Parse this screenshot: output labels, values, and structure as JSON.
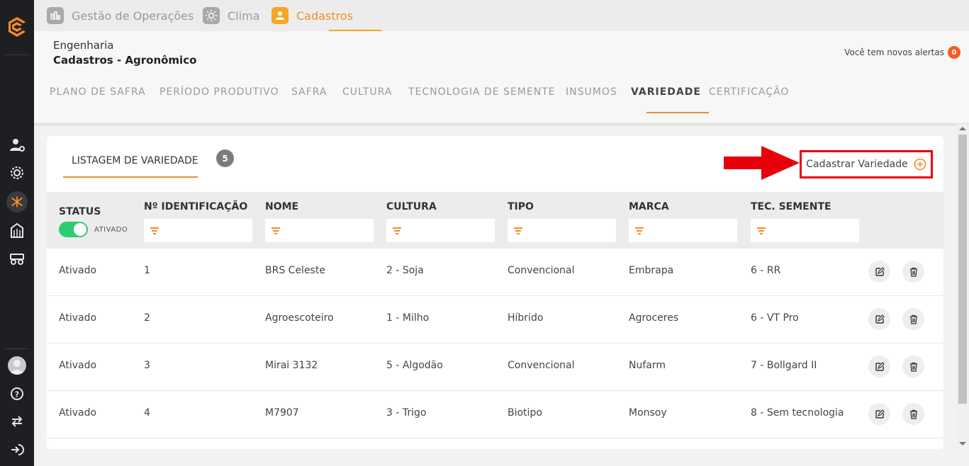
{
  "topnav": {
    "items": [
      {
        "label": "Gestão de Operações",
        "icon": "operations-icon",
        "active": false
      },
      {
        "label": "Clima",
        "icon": "sun-icon",
        "active": false
      },
      {
        "label": "Cadastros",
        "icon": "user-icon",
        "active": true
      }
    ]
  },
  "header": {
    "subtitle": "Engenharia",
    "title": "Cadastros - Agronômico",
    "alerts_label": "Você tem novos alertas",
    "alerts_count": "0"
  },
  "subtabs": [
    "PLANO DE SAFRA",
    "PERÍODO PRODUTIVO",
    "SAFRA",
    "CULTURA",
    "TECNOLOGIA DE SEMENTE",
    "INSUMOS",
    "VARIEDADE",
    "CERTIFICAÇÃO"
  ],
  "active_subtab": "VARIEDADE",
  "list": {
    "tab_label": "LISTAGEM DE VARIEDADE",
    "count": "5",
    "add_button_label": "Cadastrar Variedade",
    "accent_color": "#f28c28",
    "highlight_color": "#e8000b"
  },
  "table": {
    "columns": [
      "STATUS",
      "Nº IDENTIFICAÇÃO",
      "NOME",
      "CULTURA",
      "TIPO",
      "MARCA",
      "TEC. SEMENTE"
    ],
    "status_filter_label": "ATIVADO",
    "status_filter_on": true,
    "rows": [
      [
        "Ativado",
        "1",
        "BRS Celeste",
        "2 - Soja",
        "Convencional",
        "Embrapa",
        "6 - RR"
      ],
      [
        "Ativado",
        "2",
        "Agroescoteiro",
        "1 - Milho",
        "Híbrido",
        "Agroceres",
        "6 - VT Pro"
      ],
      [
        "Ativado",
        "3",
        "Mirai 3132",
        "5 - Algodão",
        "Convencional",
        "Nufarm",
        "7 - Bollgard II"
      ],
      [
        "Ativado",
        "4",
        "M7907",
        "3 - Trigo",
        "Biotipo",
        "Monsoy",
        "8 - Sem tecnologia"
      ]
    ]
  }
}
